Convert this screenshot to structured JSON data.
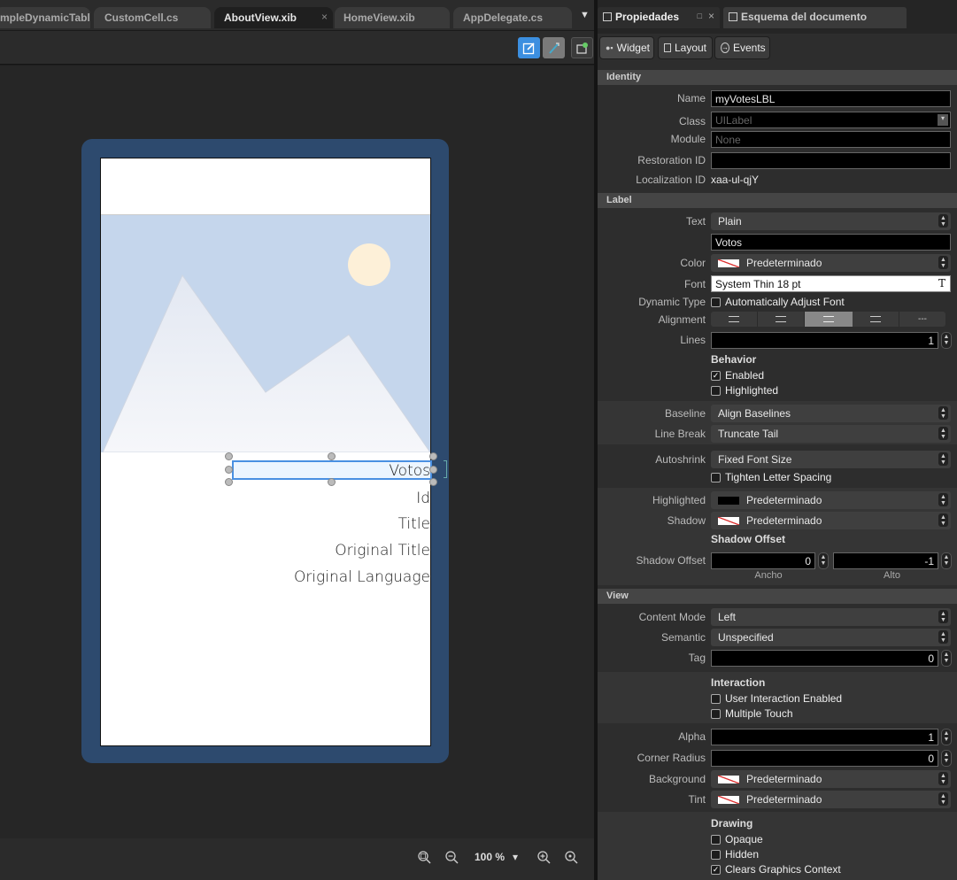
{
  "tabs": [
    "mpleDynamicTabl",
    "CustomCell.cs",
    "AboutView.xib",
    "HomeView.xib",
    "AppDelegate.cs"
  ],
  "tab_close": "×",
  "tab_menu": "▼",
  "mock": {
    "labels": [
      "Votos",
      "Id",
      "Title",
      "Original Title",
      "Original Language"
    ]
  },
  "zoom": {
    "value": "100 %",
    "arrow": "▾"
  },
  "panel": {
    "tabs": [
      "Propiedades",
      "Esquema del documento"
    ],
    "buttons": [
      "Widget",
      "Layout",
      "Events"
    ],
    "sections": {
      "identity": "Identity",
      "label": "Label",
      "view": "View"
    },
    "identity": {
      "name_label": "Name",
      "name": "myVotesLBL",
      "class_label": "Class",
      "class": "UILabel",
      "module_label": "Module",
      "module": "None",
      "restoration_label": "Restoration ID",
      "restoration": "",
      "localization_label": "Localization ID",
      "localization": "xaa-ul-qjY"
    },
    "label": {
      "text_label": "Text",
      "text_type": "Plain",
      "text_value": "Votos",
      "color_label": "Color",
      "color": "Predeterminado",
      "font_label": "Font",
      "font": "System Thin 18 pt",
      "font_icon": "T",
      "dyn_label": "Dynamic Type",
      "dyn": "Automatically Adjust Font",
      "align_label": "Alignment",
      "align_more": "---",
      "lines_label": "Lines",
      "lines": "1",
      "behavior": "Behavior",
      "enabled": "Enabled",
      "highlighted": "Highlighted",
      "baseline_label": "Baseline",
      "baseline": "Align Baselines",
      "linebreak_label": "Line Break",
      "linebreak": "Truncate Tail",
      "autoshrink_label": "Autoshrink",
      "autoshrink": "Fixed Font Size",
      "tighten": "Tighten Letter Spacing",
      "hl_label": "Highlighted",
      "hl": "Predeterminado",
      "shadow_label": "Shadow",
      "shadow": "Predeterminado",
      "shadow_offset_head": "Shadow Offset",
      "shadow_offset_label": "Shadow Offset",
      "offset_w": "0",
      "offset_h": "-1",
      "ancho": "Ancho",
      "alto": "Alto"
    },
    "view": {
      "content_label": "Content Mode",
      "content": "Left",
      "semantic_label": "Semantic",
      "semantic": "Unspecified",
      "tag_label": "Tag",
      "tag": "0",
      "interaction": "Interaction",
      "uie": "User Interaction Enabled",
      "multi": "Multiple Touch",
      "alpha_label": "Alpha",
      "alpha": "1",
      "corner_label": "Corner Radius",
      "corner": "0",
      "bg_label": "Background",
      "bg": "Predeterminado",
      "tint_label": "Tint",
      "tint": "Predeterminado",
      "drawing": "Drawing",
      "opaque": "Opaque",
      "hidden": "Hidden",
      "clears": "Clears Graphics Context"
    }
  },
  "colors": {
    "accent": "#3c8fe0",
    "device": "#2d4a6e",
    "panel": "#2d2d2d"
  }
}
